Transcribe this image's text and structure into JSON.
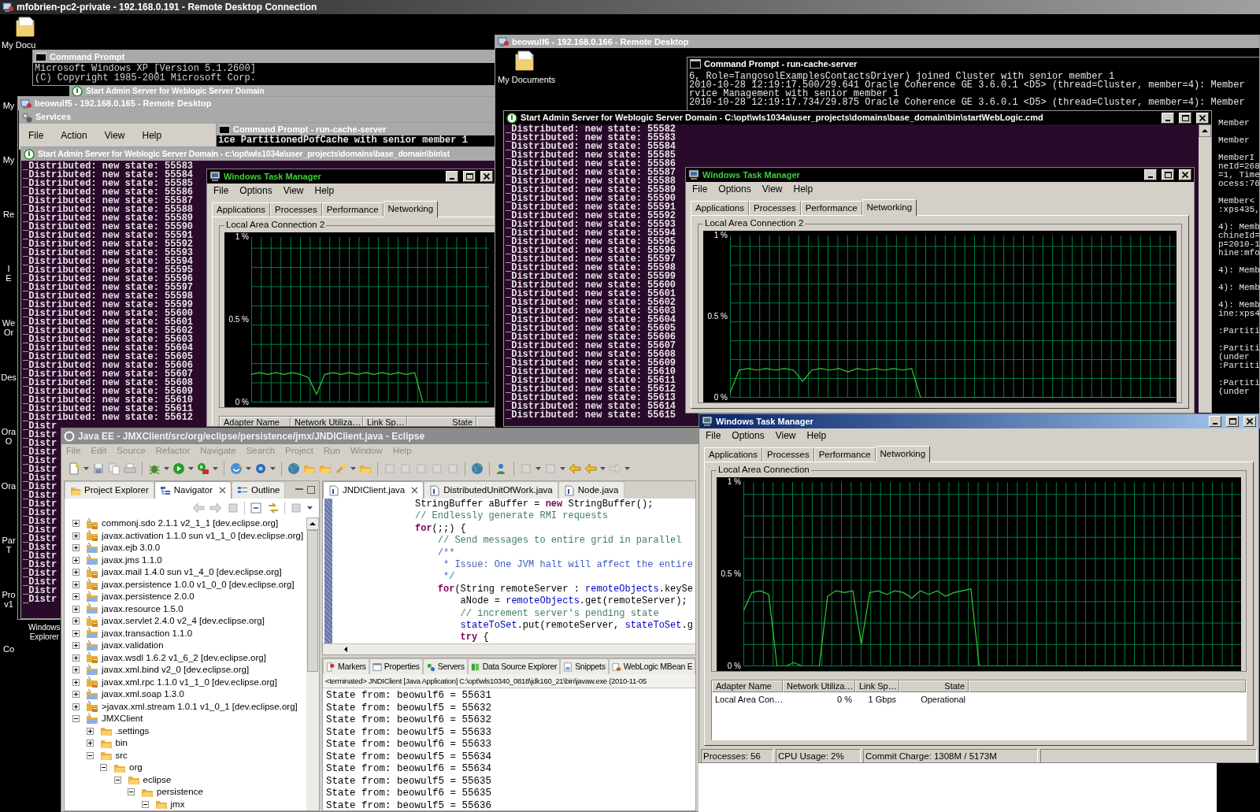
{
  "session_title": "mfobrien-pc2-private - 192.168.0.191 - Remote Desktop Connection",
  "desktop": {
    "top_label": "My Docu",
    "side_labels": [
      [
        "My"
      ],
      [
        "My"
      ],
      [
        "Re"
      ],
      [
        "I",
        "E"
      ],
      [
        "We",
        "Or"
      ],
      [
        "Des"
      ],
      [
        "Ora",
        "O"
      ],
      [
        "Ora"
      ],
      [
        "Par",
        "T"
      ],
      [
        "Pro",
        "v1"
      ],
      [
        "Co"
      ]
    ],
    "explorer_label": [
      "Windows",
      "Explorer"
    ]
  },
  "command_prompt": {
    "title": "Command Prompt",
    "lines": [
      "Microsoft Windows XP [Version 5.1.2600]",
      "(C) Copyright 1985-2001 Microsoft Corp."
    ]
  },
  "background_window": {
    "title": "Start Admin Server for Weblogic Server Domain"
  },
  "beowulf5": {
    "title": "beowulf5 - 192.168.0.165 - Remote Desktop",
    "services": {
      "title": "Services",
      "menu": [
        "File",
        "Action",
        "View",
        "Help"
      ]
    },
    "cache_server": {
      "title": "Command Prompt - run-cache-server",
      "lines": [
        "ice PartitionedPofCache with senior member 1"
      ]
    },
    "admin_server": {
      "title": "Start Admin Server for Weblogic Server Domain - c:\\opt\\wls1034a\\user_projects\\domains\\base_domain\\bin\\st",
      "lines": [
        "_Distributed: new state: 55583",
        "_Distributed: new state: 55584",
        "_Distributed: new state: 55585",
        "_Distributed: new state: 55586",
        "_Distributed: new state: 55587",
        "_Distributed: new state: 55588",
        "_Distributed: new state: 55589",
        "_Distributed: new state: 55590",
        "_Distributed: new state: 55591",
        "_Distributed: new state: 55592",
        "_Distributed: new state: 55593",
        "_Distributed: new state: 55594",
        "_Distributed: new state: 55595",
        "_Distributed: new state: 55596",
        "_Distributed: new state: 55597",
        "_Distributed: new state: 55598",
        "_Distributed: new state: 55599",
        "_Distributed: new state: 55600",
        "_Distributed: new state: 55601",
        "_Distributed: new state: 55602",
        "_Distributed: new state: 55603",
        "_Distributed: new state: 55604",
        "_Distributed: new state: 55605",
        "_Distributed: new state: 55606",
        "_Distributed: new state: 55607",
        "_Distributed: new state: 55608",
        "_Distributed: new state: 55609",
        "_Distributed: new state: 55610",
        "_Distributed: new state: 55611",
        "_Distributed: new state: 55612",
        "_Distr",
        "_Distr",
        "_Distr",
        "_Distr",
        "_Distr",
        "_Distr",
        "_Distr",
        "_Distr",
        "_Distr",
        "_Distr",
        "_Distr",
        "_Distr",
        "_Distr",
        "_Distr",
        "_Distr",
        "_Distr",
        "_Distr",
        "_Distr",
        "_Distr",
        "_Distr",
        "_Distr"
      ]
    },
    "task_manager": {
      "title": "Windows Task Manager",
      "active": false,
      "menu": [
        "File",
        "Options",
        "View",
        "Help"
      ],
      "tabs": [
        {
          "label": "Applications",
          "selected": false
        },
        {
          "label": "Processes",
          "selected": false
        },
        {
          "label": "Performance",
          "selected": false
        },
        {
          "label": "Networking",
          "selected": true
        }
      ],
      "group": "Local Area Connection 2",
      "chart_data": {
        "type": "line",
        "ylim": [
          0,
          1
        ],
        "yticks": [
          {
            "value": 1,
            "label": "1 %"
          },
          {
            "value": 0.5,
            "label": "0.5 %"
          },
          {
            "value": 0,
            "label": "0 %"
          }
        ],
        "grid": true,
        "series": [
          {
            "color": "#33cc33",
            "values": [
              0.17,
              0.18,
              0.17,
              0.18,
              0.17,
              0.18,
              0.17,
              0.15,
              0.05,
              0.17,
              0.18,
              0.17,
              0.18,
              0.17,
              0.18,
              0.17,
              0.18,
              0.17,
              0.18,
              0.17,
              0.18,
              0,
              0,
              0,
              0,
              0,
              0,
              0,
              0,
              0
            ]
          }
        ]
      },
      "columns": [
        "Adapter Name",
        "Network Utiliza…",
        "Link Sp…",
        "State"
      ]
    }
  },
  "beowulf6": {
    "title": "beowulf6 - 192.168.0.166 - Remote Desktop",
    "desktop_label": "My Documents",
    "cache_server": {
      "title": "Command Prompt - run-cache-server",
      "lines": [
        "6, Role=TangosolExamplesContactsDriver) joined Cluster with senior member 1",
        "2010-10-28 12:19:17.500/29.641 Oracle Coherence GE 3.6.0.1 <D5> (thread=Cluster, member=4): Member",
        "rvice Management with senior member 1",
        "2010-10-28 12:19:17.734/29.875 Oracle Coherence GE 3.6.0.1 <D5> (thread=Cluster, member=4): Member"
      ],
      "edge_groups": [
        [
          "Member"
        ],
        [
          "Member"
        ],
        [
          "MemberI",
          "neId=268",
          "=1, Time",
          "ocess:76"
        ],
        [
          "Member<",
          ":xps435,"
        ],
        [
          "4): Memb",
          "chineId=",
          "p=2010-1",
          "hine:mfo"
        ],
        [
          "4): Memb"
        ],
        [
          "4): Memb"
        ],
        [
          "4): Memb",
          "ine:xps4"
        ],
        [
          ":Partiti"
        ],
        [
          ":Partiti",
          "(under",
          ":Partiti"
        ],
        [
          ":Partiti",
          "(under"
        ]
      ]
    },
    "admin_server": {
      "title": "Start Admin Server for Weblogic Server Domain - C:\\opt\\wls1034a\\user_projects\\domains\\base_domain\\bin\\startWebLogic.cmd",
      "lines": [
        "_Distributed: new state: 55582",
        "_Distributed: new state: 55583",
        "_Distributed: new state: 55584",
        "_Distributed: new state: 55585",
        "_Distributed: new state: 55586",
        "_Distributed: new state: 55587",
        "_Distributed: new state: 55588",
        "_Distributed: new state: 55589",
        "_Distributed: new state: 55590",
        "_Distributed: new state: 55591",
        "_Distributed: new state: 55592",
        "_Distributed: new state: 55593",
        "_Distributed: new state: 55594",
        "_Distributed: new state: 55595",
        "_Distributed: new state: 55596",
        "_Distributed: new state: 55597",
        "_Distributed: new state: 55598",
        "_Distributed: new state: 55599",
        "_Distributed: new state: 55600",
        "_Distributed: new state: 55601",
        "_Distributed: new state: 55602",
        "_Distributed: new state: 55603",
        "_Distributed: new state: 55604",
        "_Distributed: new state: 55605",
        "_Distributed: new state: 55606",
        "_Distributed: new state: 55607",
        "_Distributed: new state: 55608",
        "_Distributed: new state: 55609",
        "_Distributed: new state: 55610",
        "_Distributed: new state: 55611",
        "_Distributed: new state: 55612",
        "_Distributed: new state: 55613",
        "_Distributed: new state: 55614",
        "_Distributed: new state: 55615"
      ]
    },
    "task_manager": {
      "title": "Windows Task Manager",
      "active": false,
      "menu": [
        "File",
        "Options",
        "View",
        "Help"
      ],
      "tabs": [
        {
          "label": "Applications",
          "selected": false
        },
        {
          "label": "Processes",
          "selected": false
        },
        {
          "label": "Performance",
          "selected": false
        },
        {
          "label": "Networking",
          "selected": true
        }
      ],
      "group": "Local Area Connection 2",
      "chart_data": {
        "type": "line",
        "ylim": [
          0,
          1
        ],
        "yticks": [
          {
            "value": 1,
            "label": "1 %"
          },
          {
            "value": 0.5,
            "label": "0.5 %"
          },
          {
            "value": 0,
            "label": "0 %"
          }
        ],
        "grid": true,
        "series": [
          {
            "color": "#33cc33",
            "values": [
              0.03,
              0.17,
              0.18,
              0.17,
              0.18,
              0.17,
              0.18,
              0.17,
              0.1,
              0.17,
              0.18,
              0.17,
              0.18,
              0.16,
              0.18,
              0.17,
              0.18,
              0.17,
              0.18,
              0.17,
              0.18,
              0,
              0,
              0,
              0,
              0,
              0,
              0,
              0,
              0,
              0,
              0,
              0,
              0,
              0,
              0,
              0,
              0,
              0,
              0,
              0,
              0,
              0,
              0,
              0,
              0,
              0,
              0,
              0,
              0
            ]
          }
        ]
      }
    }
  },
  "eclipse": {
    "title": "Java EE - JMXClient/src/org/eclipse/persistence/jmx/JNDIClient.java - Eclipse",
    "menu": [
      "File",
      "Edit",
      "Source",
      "Refactor",
      "Navigate",
      "Search",
      "Project",
      "Run",
      "Window",
      "Help"
    ],
    "view_tabs": [
      {
        "label": "Project Explorer",
        "selected": false
      },
      {
        "label": "Navigator",
        "selected": true
      },
      {
        "label": "Outline",
        "selected": false
      }
    ],
    "tree": [
      {
        "label": "commonj.sdo 2.1.1 v2_1_1 [dev.eclipse.org]",
        "kind": "jar_project",
        "expanded": false
      },
      {
        "label": "javax.activation 1.1.0 sun v1_1_0 [dev.eclipse.org]",
        "kind": "jar_project",
        "expanded": false
      },
      {
        "label": "javax.ejb 3.0.0",
        "kind": "project",
        "expanded": false
      },
      {
        "label": "javax.jms 1.1.0",
        "kind": "project",
        "expanded": false
      },
      {
        "label": "javax.mail 1.4.0 sun v1_4_0 [dev.eclipse.org]",
        "kind": "jar_project",
        "expanded": false
      },
      {
        "label": "javax.persistence 1.0.0 v1_0_0 [dev.eclipse.org]",
        "kind": "jar_project",
        "expanded": false
      },
      {
        "label": "javax.persistence 2.0.0",
        "kind": "project",
        "expanded": false
      },
      {
        "label": "javax.resource 1.5.0",
        "kind": "project",
        "expanded": false
      },
      {
        "label": "javax.servlet 2.4.0 v2_4 [dev.eclipse.org]",
        "kind": "jar_project",
        "expanded": false
      },
      {
        "label": "javax.transaction 1.1.0",
        "kind": "project",
        "expanded": false
      },
      {
        "label": "javax.validation",
        "kind": "project",
        "expanded": false
      },
      {
        "label": "javax.wsdl 1.6.2 v1_6_2 [dev.eclipse.org]",
        "kind": "jar_project",
        "expanded": false
      },
      {
        "label": "javax.xml.bind v2_0 [dev.eclipse.org]",
        "kind": "project",
        "expanded": false
      },
      {
        "label": "javax.xml.rpc 1.1.0 v1_1_0 [dev.eclipse.org]",
        "kind": "jar_project",
        "expanded": false
      },
      {
        "label": "javax.xml.soap 1.3.0",
        "kind": "project",
        "expanded": false
      },
      {
        "label": ">javax.xml.stream 1.0.1 v1_0_1 [dev.eclipse.org]",
        "kind": "jar_project",
        "expanded": false
      },
      {
        "label": "JMXClient",
        "kind": "project",
        "expanded": true,
        "children": [
          {
            "label": ".settings",
            "kind": "folder",
            "expanded": false
          },
          {
            "label": "bin",
            "kind": "folder",
            "expanded": false
          },
          {
            "label": "src",
            "kind": "folder",
            "expanded": true,
            "children": [
              {
                "label": "org",
                "kind": "folder",
                "expanded": true,
                "children": [
                  {
                    "label": "eclipse",
                    "kind": "folder",
                    "expanded": true,
                    "children": [
                      {
                        "label": "persistence",
                        "kind": "folder",
                        "expanded": true,
                        "children": [
                          {
                            "label": "jmx",
                            "kind": "folder",
                            "expanded": true
                          }
                        ]
                      }
                    ]
                  }
                ]
              }
            ]
          }
        ]
      }
    ],
    "editor_tabs": [
      {
        "label": "JNDIClient.java",
        "selected": true
      },
      {
        "label": "DistributedUnitOfWork.java",
        "selected": false
      },
      {
        "label": "Node.java",
        "selected": false
      }
    ],
    "code_lines": [
      [
        {
          "kind": "plain",
          "text": "StringBuffer aBuffer = "
        },
        {
          "kind": "keyword",
          "text": "new"
        },
        {
          "kind": "plain",
          "text": " StringBuffer();"
        }
      ],
      [
        {
          "kind": "comment",
          "text": "// Endlessly generate RMI requests"
        }
      ],
      [
        {
          "kind": "keyword",
          "text": "for"
        },
        {
          "kind": "plain",
          "text": "(;;) {"
        }
      ],
      [
        {
          "kind": "comment",
          "text": "    // Send messages to entire grid in parallel"
        }
      ],
      [
        {
          "kind": "javadoc",
          "text": "    /**"
        }
      ],
      [
        {
          "kind": "javadoc",
          "text": "     * Issue: One JVM halt will affect the entire"
        }
      ],
      [
        {
          "kind": "javadoc",
          "text": "     */"
        }
      ],
      [
        {
          "kind": "keyword",
          "text": "    for"
        },
        {
          "kind": "plain",
          "text": "(String remoteServer : "
        },
        {
          "kind": "field",
          "text": "remoteObjects"
        },
        {
          "kind": "plain",
          "text": ".keySe"
        }
      ],
      [
        {
          "kind": "plain",
          "text": "        aNode = "
        },
        {
          "kind": "field",
          "text": "remoteObjects"
        },
        {
          "kind": "plain",
          "text": ".get(remoteServer);"
        }
      ],
      [
        {
          "kind": "comment",
          "text": "        // increment server's pending state"
        }
      ],
      [
        {
          "kind": "field",
          "text": "        stateToSet"
        },
        {
          "kind": "plain",
          "text": ".put(remoteServer, "
        },
        {
          "kind": "field",
          "text": "stateToSet"
        },
        {
          "kind": "plain",
          "text": ".g"
        }
      ],
      [
        {
          "kind": "keyword",
          "text": "        try"
        },
        {
          "kind": "plain",
          "text": " {"
        }
      ]
    ],
    "bottom_tabs": [
      {
        "label": "Markers",
        "selected": false
      },
      {
        "label": "Properties",
        "selected": false
      },
      {
        "label": "Servers",
        "selected": false
      },
      {
        "label": "Data Source Explorer",
        "selected": false
      },
      {
        "label": "Snippets",
        "selected": false
      },
      {
        "label": "WebLogic MBean E",
        "selected": false
      }
    ],
    "console_header": "<terminated> JNDIClient [Java Application] C:\\opt\\wls10340_0818\\jdk160_21\\bin\\javaw.exe (2010-11-05",
    "console_lines": [
      "State from: beowulf6 = 55631",
      "State from: beowulf5 = 55632",
      "State from: beowulf6 = 55632",
      "State from: beowulf5 = 55633",
      "State from: beowulf6 = 55633",
      "State from: beowulf5 = 55634",
      "State from: beowulf6 = 55634",
      "State from: beowulf5 = 55635",
      "State from: beowulf6 = 55635",
      "State from: beowulf5 = 55636"
    ]
  },
  "task_manager": {
    "title": "Windows Task Manager",
    "active": true,
    "menu": [
      "File",
      "Options",
      "View",
      "Help"
    ],
    "tabs": [
      {
        "label": "Applications",
        "selected": false
      },
      {
        "label": "Processes",
        "selected": false
      },
      {
        "label": "Performance",
        "selected": false
      },
      {
        "label": "Networking",
        "selected": true
      }
    ],
    "group": "Local Area Connection",
    "chart_data": {
      "type": "line",
      "ylim": [
        0,
        1
      ],
      "yticks": [
        {
          "value": 1,
          "label": "1 %"
        },
        {
          "value": 0.5,
          "label": "0.5 %"
        },
        {
          "value": 0,
          "label": "0 %"
        }
      ],
      "grid": true,
      "series": [
        {
          "color": "#33cc33",
          "values": [
            0.3,
            0.4,
            0.41,
            0.39,
            0,
            0,
            0.02,
            0,
            0,
            0,
            0.38,
            0.41,
            0.4,
            0.41,
            0.12,
            0.4,
            0.41,
            0.39,
            0.41,
            0.4,
            0.37,
            0.41,
            0.39,
            0.41,
            0.38,
            0.4,
            0.41,
            0.42,
            0,
            0,
            0,
            0,
            0,
            0,
            0,
            0,
            0,
            0,
            0,
            0,
            0,
            0,
            0,
            0,
            0,
            0,
            0,
            0,
            0,
            0,
            0,
            0,
            0,
            0,
            0,
            0,
            0,
            0,
            0,
            0
          ]
        }
      ]
    },
    "columns": [
      "Adapter Name",
      "Network Utiliza…",
      "Link Sp…",
      "State"
    ],
    "rows": [
      [
        "Local Area Con…",
        "0 %",
        "1 Gbps",
        "Operational"
      ]
    ],
    "status": [
      "Processes: 56",
      "CPU Usage: 2%",
      "Commit Charge: 1308M / 5173M"
    ]
  }
}
